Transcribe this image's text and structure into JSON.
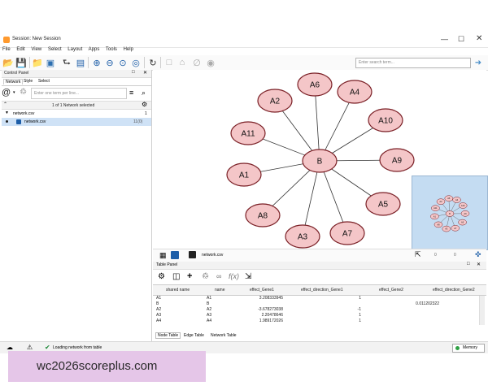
{
  "window": {
    "title": "Session: New Session"
  },
  "menu": [
    "File",
    "Edit",
    "View",
    "Select",
    "Layout",
    "Apps",
    "Tools",
    "Help"
  ],
  "search": {
    "placeholder": "Enter search term..."
  },
  "control_panel": {
    "title": "Control Panel",
    "tabs": [
      "Network",
      "Style",
      "Select"
    ],
    "search_placeholder": "Enter one term per line...",
    "count_text": "1 of 1 Network selected",
    "collection": {
      "name": "network.csv",
      "count": "1"
    },
    "network": {
      "name": "network.csv",
      "counts": "11(0)"
    }
  },
  "network_view": {
    "name": "network.csv",
    "center": "B",
    "nodes": [
      "A6",
      "A4",
      "A2",
      "A10",
      "A11",
      "A9",
      "A1",
      "A5",
      "A8",
      "A3",
      "A7"
    ],
    "status_edges": "0",
    "status_nodes": "0"
  },
  "table_panel": {
    "title": "Table Panel",
    "columns": [
      "shared name",
      "name",
      "effect_Gene1",
      "effect_direction_Gene1",
      "effect_Gene2",
      "effect_direction_Gene2"
    ],
    "rows": [
      [
        "A1",
        "A1",
        "3.208333945",
        "1",
        "",
        ""
      ],
      [
        "B",
        "B",
        "",
        "",
        "0.011202322",
        ""
      ],
      [
        "A2",
        "A2",
        "-3.678273038",
        "-1",
        "",
        ""
      ],
      [
        "A3",
        "A3",
        "2.20478646",
        "1",
        "",
        ""
      ],
      [
        "A4",
        "A4",
        "1.989172026",
        "1",
        "",
        ""
      ]
    ],
    "tabs": [
      "Node Table",
      "Edge Table",
      "Network Table"
    ]
  },
  "status_bar": {
    "message": "Loading network from table",
    "memory": "Memory"
  },
  "watermark": "wc2026scoreplus.com",
  "colors": {
    "node_fill": "#f4c6c8",
    "node_stroke": "#7a1f25",
    "accent": "#4a8ec8"
  }
}
